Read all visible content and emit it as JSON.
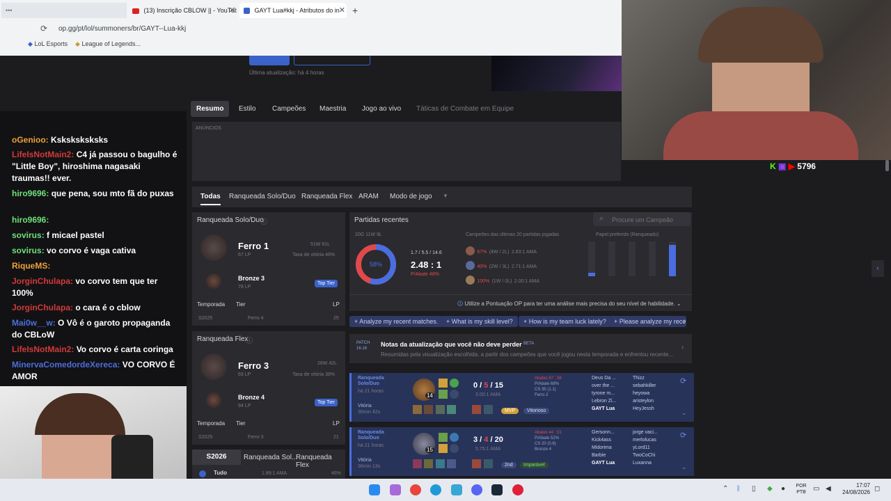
{
  "browser": {
    "tabs": [
      {
        "label": "(13) Inscrição CBLOW || - YouTub"
      },
      {
        "label": "GAYT Lua#kkj - Atributos do in"
      }
    ],
    "new_tab": "+",
    "address": "op.gg/pt/lol/summoners/br/GAYT--Lua-kkj",
    "bookmarks": [
      "LoL Esports",
      "League of Legends..."
    ]
  },
  "profile": {
    "update_note": "Última atualização: há 4 horas",
    "nav_tabs": [
      "Resumo",
      "Estilo",
      "Campeões",
      "Maestria",
      "Jogo ao vivo",
      "Táticas de Combate em Equipe"
    ],
    "ads_label": "ANÚNCIOS"
  },
  "queue_tabs": [
    "Todas",
    "Ranqueada Solo/Duo",
    "Ranqueada Flex",
    "ARAM",
    "Modo de jogo"
  ],
  "solo": {
    "title": "Ranqueada Solo/Duo",
    "rank": "Ferro 1",
    "lp": "67 LP",
    "record": "51W 61L",
    "winrate": "Taxa de vitória 46%",
    "peak_rank": "Bronze 3",
    "peak_lp": "78 LP",
    "badge": "Top Tier",
    "headers": [
      "Temporada",
      "Tier",
      "LP"
    ],
    "row": {
      "season": "S2025",
      "tier": "Ferro 4",
      "lp": "25"
    }
  },
  "flex": {
    "title": "Ranqueada Flex",
    "rank": "Ferro 3",
    "lp": "69 LP",
    "record": "26W 42L",
    "winrate": "Taxa de vitória 38%",
    "peak_rank": "Bronze 4",
    "peak_lp": "94 LP",
    "badge": "Top Tier",
    "headers": [
      "Temporada",
      "Tier",
      "LP"
    ],
    "row": {
      "season": "S2025",
      "tier": "Ferro 3",
      "lp": "21"
    }
  },
  "bottom_tabs": [
    "S2026",
    "Ranqueada Sol...",
    "Ranqueada Flex"
  ],
  "bottom_row": {
    "label": "Tudo",
    "value": "1.89:1 AMA",
    "pct": "46%"
  },
  "recent": {
    "title": "Partidas recentes",
    "search_placeholder": "Procure um Campeão",
    "record": "20G 11W 9L",
    "winrate_label": "58%",
    "winrate": 0.55,
    "kda_line": "1.7 / 5.5 / 14.6",
    "kda": "2.48 : 1",
    "kill_part": "P/Abate 48%",
    "champs_title": "Campeões das últimas 20 partidas jogadas",
    "champs": [
      {
        "pct": "67%",
        "wl": "(4W / 2L)",
        "kda": "2.83:1 AMA"
      },
      {
        "pct": "40%",
        "wl": "(2W / 3L)",
        "kda": "2.71:1 AMA"
      },
      {
        "pct": "100%",
        "wl": "(1W / 0L)",
        "kda": "2.00:1 AMA"
      }
    ],
    "role_title": "Papel preferido (Ranqueado)",
    "roles": [
      0.1,
      0.0,
      0.0,
      0.0,
      0.9
    ],
    "tip": "Utilize a Pontuação OP para ter uma análise mais precisa do seu nível de habilidade.",
    "ai_chips": [
      "Analyze my recent matches.",
      "What is my skill level?",
      "How is my team luck lately?",
      "Please analyze my rece"
    ],
    "patch": {
      "badge": "PATCH 16.16",
      "title": "Notas da atualização que você não deve perder",
      "beta": "BETA",
      "desc": "Resumidas pela visualização escolhida, a partir dos campeões que você jogou nesta temporada e enfrentou recente..."
    }
  },
  "matches": [
    {
      "queue": "Ranqueada Solo/Duo",
      "time": "há 21 horas",
      "result": "Vitória",
      "duration": "30min 42s",
      "level": "14",
      "k": "0",
      "d": "5",
      "a": "15",
      "kda": "3.00:1 AMA",
      "stats": [
        "Abates 67 : 38",
        "P/Abate 68%",
        "CS 35 (1.1)",
        "Ferro 2"
      ],
      "badges": [
        "MVP",
        "Vitorioso"
      ],
      "team1": [
        "Deus Da ...",
        "over the ...",
        "tyrone m...",
        "Lebron Zi...",
        "GAYT Lua"
      ],
      "team2": [
        "Thizz",
        "sebahkiller",
        "heyowa",
        "aristeylon",
        "HeyJessh"
      ]
    },
    {
      "queue": "Ranqueada Solo/Duo",
      "time": "há 21 horas",
      "result": "Vitória",
      "duration": "36min 13s",
      "level": "15",
      "k": "3",
      "d": "4",
      "a": "20",
      "kda": "5.75:1 AMA",
      "stats": [
        "Abates 44 : 51",
        "P/Abate 52%",
        "CS 20 (0.6)",
        "Bronze 4"
      ],
      "badges": [
        "2nd",
        "Imparável"
      ],
      "team1": [
        "Gersonn...",
        "Kick4ass",
        "Midorima",
        "Barbie",
        "GAYT Lua"
      ],
      "team2": [
        "jorge vaci...",
        "merlolucas",
        "yLord11",
        "TwoCoChi",
        "Luxanna"
      ]
    }
  ],
  "chat": {
    "messages": [
      {
        "user": "oGenioo",
        "text": "Ksksksksksks"
      },
      {
        "user": "LifeIsNotMain2",
        "text": "C4 já passou o bagulho é \"Little Boy\", hiroshima nagasaki traumas!! ever."
      },
      {
        "user": "hiro9696",
        "text": "que pena, sou mto fã do puxas"
      },
      {
        "user": "hiro9696",
        "text": ""
      },
      {
        "user": "sovirus",
        "text": "f micael pastel"
      },
      {
        "user": "sovirus",
        "text": "vo corvo é vaga cativa"
      },
      {
        "user": "RiqueMS",
        "text": ""
      },
      {
        "user": "JorginChulapa",
        "text": "vo corvo tem que ter 100%"
      },
      {
        "user": "JorginChulapa",
        "text": "o cara é o cblow"
      },
      {
        "user": "Mai0w__w",
        "text": "O Vô é o garoto propaganda do CBLoW"
      },
      {
        "user": "LifeIsNotMain2",
        "text": "Vo corvo é carta coringa"
      },
      {
        "user": "MinervaComedordeXereca",
        "text": "VO CORVO É AMOR"
      }
    ]
  },
  "viewers": "5796",
  "system": {
    "lang": "POR PTB",
    "time": "17:07",
    "date": "24/08/2026"
  },
  "colors": {
    "accent": "#3a62c9",
    "win": "#4a6ee0",
    "loss": "#e0494c",
    "chat_bg": "#121214"
  }
}
